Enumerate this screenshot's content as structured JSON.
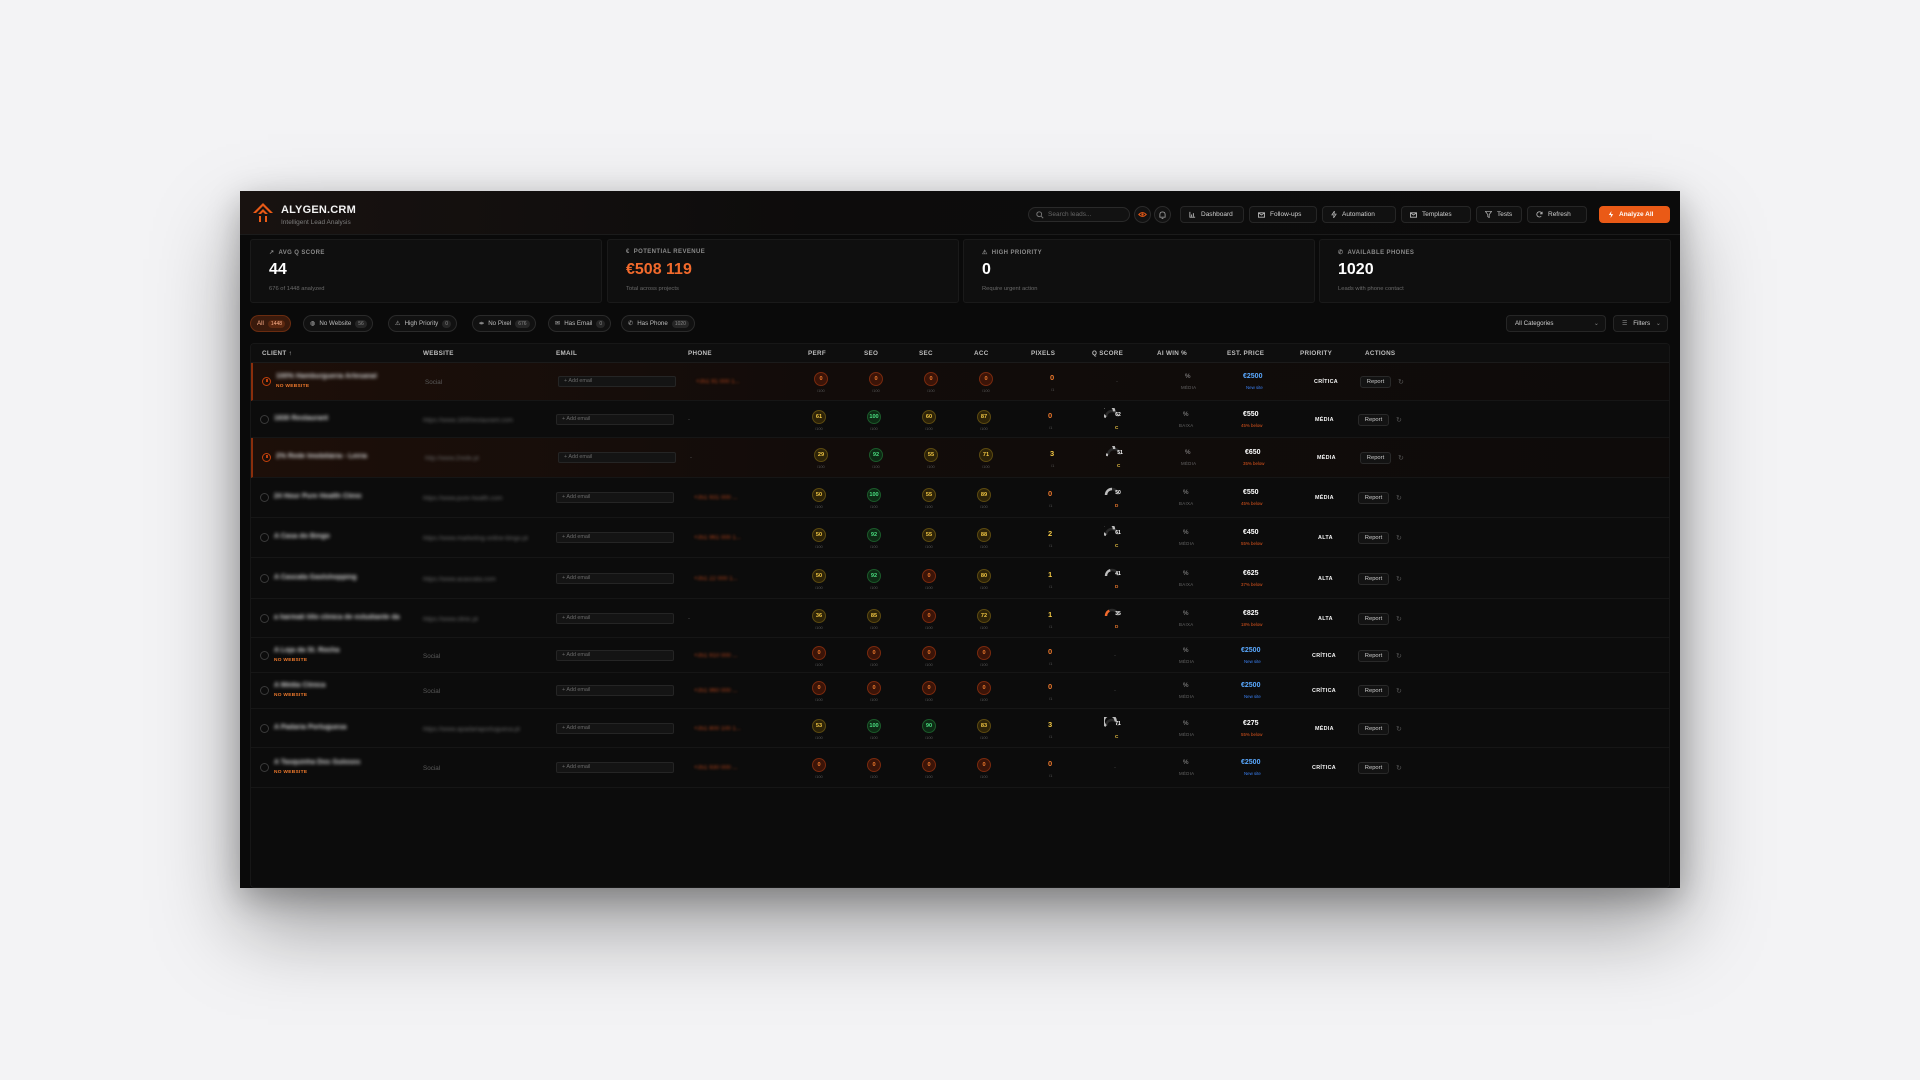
{
  "brand": {
    "title": "ALYGEN.CRM",
    "subtitle": "Intelligent Lead Analysis",
    "accent": "#ea5a16"
  },
  "search": {
    "placeholder": "Search leads..."
  },
  "nav": [
    {
      "label": "Dashboard",
      "icon": "chart-icon"
    },
    {
      "label": "Follow-ups",
      "icon": "mail-icon"
    },
    {
      "label": "Automation",
      "icon": "zap-icon"
    },
    {
      "label": "Templates",
      "icon": "mail-icon"
    },
    {
      "label": "Tests",
      "icon": "filter-icon"
    },
    {
      "label": "Refresh",
      "icon": "refresh-icon"
    },
    {
      "label": "Analyze All",
      "icon": "zap-icon"
    }
  ],
  "kpis": [
    {
      "label": "AVG Q SCORE",
      "value": "44",
      "sub": "676 of 1448 analyzed",
      "icon": "trend-icon"
    },
    {
      "label": "POTENTIAL REVENUE",
      "value": "€508 119",
      "sub": "Total across projects",
      "icon": "euro-icon"
    },
    {
      "label": "HIGH PRIORITY",
      "value": "0",
      "sub": "Require urgent action",
      "icon": "alert-icon"
    },
    {
      "label": "AVAILABLE PHONES",
      "value": "1020",
      "sub": "Leads with phone contact",
      "icon": "phone-icon"
    }
  ],
  "filters": [
    {
      "label": "All",
      "count": "1448"
    },
    {
      "label": "No Website",
      "count": "56"
    },
    {
      "label": "High Priority",
      "count": "0"
    },
    {
      "label": "No Pixel",
      "count": "676"
    },
    {
      "label": "Has Email",
      "count": "0"
    },
    {
      "label": "Has Phone",
      "count": "1020"
    }
  ],
  "category_select": "All Categories",
  "filters_button": "Filters",
  "columns": {
    "client": "CLIENT ↑",
    "website": "WEBSITE",
    "email": "EMAIL",
    "phone": "PHONE",
    "perf": "PERF",
    "seo": "SEO",
    "sec": "SEC",
    "acc": "ACC",
    "pixels": "PIXELS",
    "qscore": "Q SCORE",
    "aiwin": "AI WIN %",
    "price": "EST. PRICE",
    "priority": "PRIORITY",
    "actions": "ACTIONS"
  },
  "common": {
    "add_email": "+ Add email",
    "report": "Report",
    "slash100": "/100",
    "slash": "/1",
    "pct": "%",
    "no_website": "NO WEBSITE",
    "dash": "-",
    "social": "Social"
  },
  "rows": [
    {
      "name": "100% Hamburgueria Artesanal",
      "no_website": true,
      "website": "Social",
      "phone": "+351 91 000 1...",
      "perf": 0,
      "seo": 0,
      "sec": 0,
      "acc": 0,
      "pixels": 0,
      "q": null,
      "grade": "",
      "win_sub": "MÉDIA",
      "price": "€2500",
      "note": "New site",
      "priority": "CRÍTICA",
      "hl": true
    },
    {
      "name": "1830 Restaurant",
      "no_website": false,
      "website": "https://www.1830restaurant.com",
      "phone": "-",
      "perf": 61,
      "seo": 100,
      "sec": 60,
      "acc": 87,
      "pixels": 0,
      "q": 62,
      "grade": "C",
      "win_sub": "BAIXA",
      "price": "€550",
      "note": "45% below",
      "priority": "MÉDIA",
      "hl": false
    },
    {
      "name": "2% Rede Imobiliária - Leiria",
      "no_website": false,
      "website": "http://www.2rede.pt",
      "phone": "-",
      "perf": 29,
      "seo": 92,
      "sec": 55,
      "acc": 71,
      "pixels": 3,
      "q": 51,
      "grade": "C",
      "win_sub": "MÉDIA",
      "price": "€650",
      "note": "35% below",
      "priority": "MÉDIA",
      "hl": true
    },
    {
      "name": "24 Hour Pure Health Clinic",
      "no_website": false,
      "website": "https://www.pure-health.com",
      "phone": "+351 931 000 ...",
      "perf": 50,
      "seo": 100,
      "sec": 55,
      "acc": 89,
      "pixels": 0,
      "q": 50,
      "grade": "D",
      "win_sub": "BAIXA",
      "price": "€550",
      "note": "45% below",
      "priority": "MÉDIA",
      "hl": false
    },
    {
      "name": "A Casa do Bingo",
      "no_website": false,
      "website": "https://www.marketing-online-bingo.pt",
      "phone": "+351 961 000 1...",
      "perf": 50,
      "seo": 92,
      "sec": 55,
      "acc": 88,
      "pixels": 2,
      "q": 61,
      "grade": "C",
      "win_sub": "MÉDIA",
      "price": "€450",
      "note": "55% below",
      "priority": "ALTA",
      "hl": false
    },
    {
      "name": "A Cascata Gastshopping",
      "no_website": false,
      "website": "https://www.acascata.com",
      "phone": "+351 22 000 1...",
      "perf": 50,
      "seo": 92,
      "sec": 0,
      "acc": 80,
      "pixels": 1,
      "q": 41,
      "grade": "D",
      "win_sub": "BAIXA",
      "price": "€625",
      "note": "37% below",
      "priority": "ALTA",
      "hl": false
    },
    {
      "name": "a harmali lillo clinica de estudiante da",
      "no_website": false,
      "website": "https://www.clinic.pt",
      "phone": "-",
      "perf": 36,
      "seo": 85,
      "sec": 0,
      "acc": 72,
      "pixels": 1,
      "q": 35,
      "grade": "D",
      "win_sub": "BAIXA",
      "price": "€825",
      "note": "18% below",
      "priority": "ALTA",
      "hl": false
    },
    {
      "name": "A Loja da St. Rocha",
      "no_website": true,
      "website": "Social",
      "phone": "+351 910 000 ...",
      "perf": 0,
      "seo": 0,
      "sec": 0,
      "acc": 0,
      "pixels": 0,
      "q": null,
      "grade": "",
      "win_sub": "MÉDIA",
      "price": "€2500",
      "note": "New site",
      "priority": "CRÍTICA",
      "hl": false
    },
    {
      "name": "A Média Clínica",
      "no_website": true,
      "website": "Social",
      "phone": "+351 960 000 ...",
      "perf": 0,
      "seo": 0,
      "sec": 0,
      "acc": 0,
      "pixels": 0,
      "q": null,
      "grade": "",
      "win_sub": "MÉDIA",
      "price": "€2500",
      "note": "New site",
      "priority": "CRÍTICA",
      "hl": false
    },
    {
      "name": "A Padaria Portuguesa",
      "no_website": false,
      "website": "https://www.apadariaportuguesa.pt",
      "phone": "+351 800 100 1...",
      "perf": 53,
      "seo": 100,
      "sec": 90,
      "acc": 83,
      "pixels": 3,
      "q": 71,
      "grade": "C",
      "win_sub": "MÉDIA",
      "price": "€275",
      "note": "55% below",
      "priority": "MÉDIA",
      "hl": false
    },
    {
      "name": "A Tasquinha Dos Gulosos",
      "no_website": true,
      "website": "Social",
      "phone": "+351 930 000 ...",
      "perf": 0,
      "seo": 0,
      "sec": 0,
      "acc": 0,
      "pixels": 0,
      "q": null,
      "grade": "",
      "win_sub": "MÉDIA",
      "price": "€2500",
      "note": "New site",
      "priority": "CRÍTICA",
      "hl": false
    }
  ]
}
